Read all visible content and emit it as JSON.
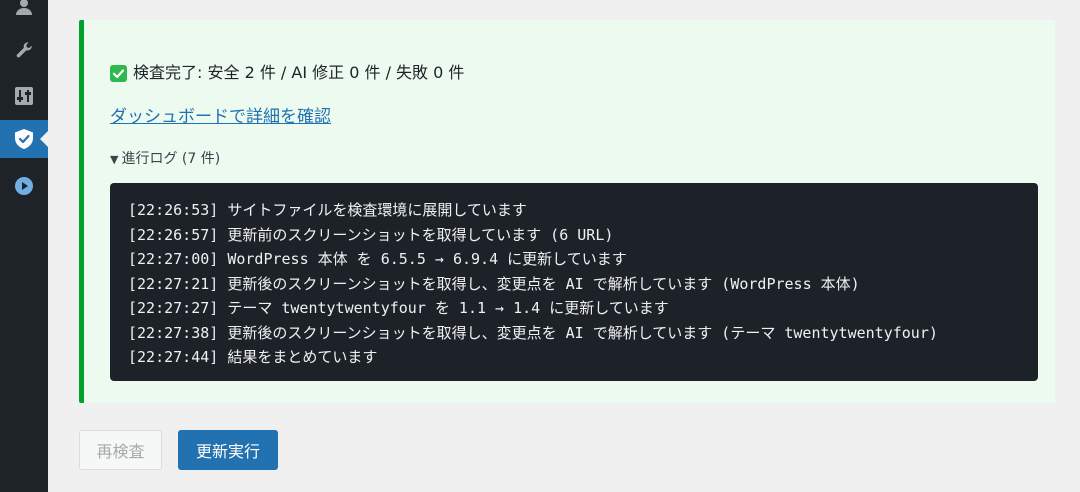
{
  "sidebar": {
    "items": [
      {
        "icon": "users-icon"
      },
      {
        "icon": "wrench-icon"
      },
      {
        "icon": "settings-sliders-icon"
      },
      {
        "icon": "shield-check-icon",
        "active": true
      },
      {
        "icon": "play-circle-icon"
      }
    ]
  },
  "notice": {
    "status_text": "検査完了: 安全 2 件 / AI 修正 0 件 / 失敗 0 件",
    "status_icon": "check-mark-icon",
    "dashboard_link": "ダッシュボードで詳細を確認",
    "log_summary": "進行ログ (7 件)",
    "log_lines": [
      "[22:26:53] サイトファイルを検査環境に展開しています",
      "[22:26:57] 更新前のスクリーンショットを取得しています (6 URL)",
      "[22:27:00] WordPress 本体 を 6.5.5 → 6.9.4 に更新しています",
      "[22:27:21] 更新後のスクリーンショットを取得し、変更点を AI で解析しています (WordPress 本体)",
      "[22:27:27] テーマ twentytwentyfour を 1.1 → 1.4 に更新しています",
      "[22:27:38] 更新後のスクリーンショットを取得し、変更点を AI で解析しています (テーマ twentytwentyfour)",
      "[22:27:44] 結果をまとめています"
    ]
  },
  "actions": {
    "recheck_label": "再検査",
    "update_label": "更新実行"
  },
  "colors": {
    "accent": "#2271b1",
    "success_border": "#00a32a",
    "notice_bg": "#edfaef",
    "log_bg": "#1d2229"
  }
}
